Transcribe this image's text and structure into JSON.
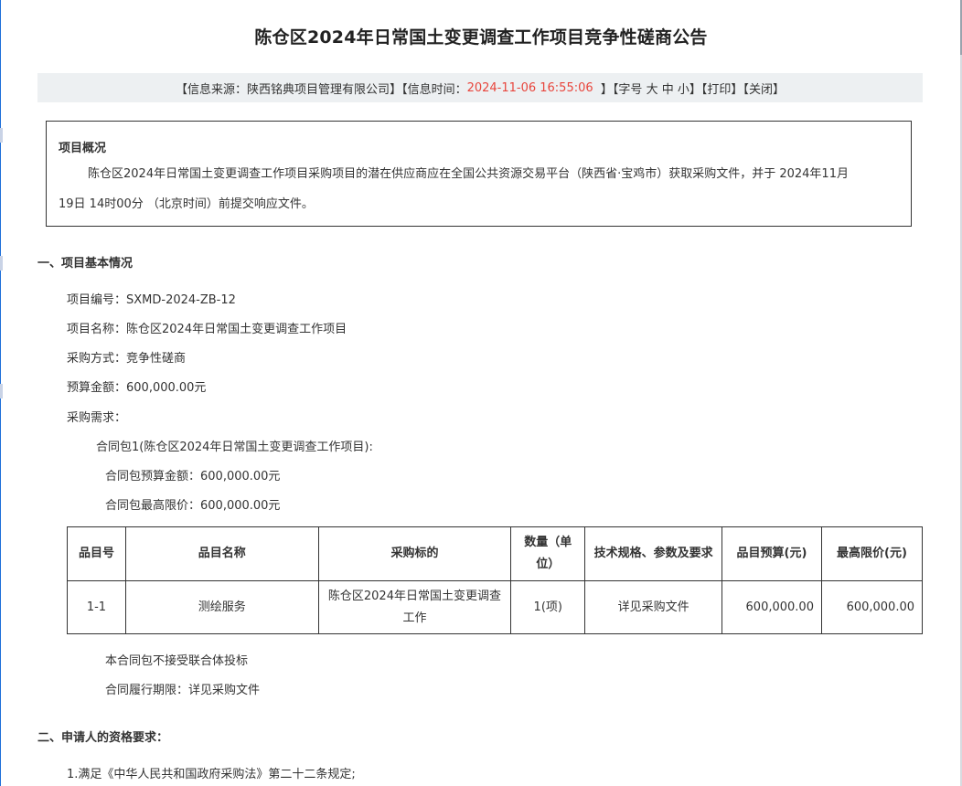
{
  "page": {
    "title": "陈仓区2024年日常国土变更调查工作项目竞争性磋商公告"
  },
  "info_bar": {
    "source_prefix": "【信息来源：",
    "source": "陕西铭典项目管理有限公司",
    "source_suffix": "】【信息时间：",
    "time": "2024-11-06 16:55:06",
    "time_suffix": "  】【字号 ",
    "font_large": "大",
    "font_medium": "中",
    "font_small": "小",
    "font_suffix": "】【",
    "print": "打印",
    "mid": "】【",
    "close": "关闭",
    "end": "】",
    "time_color": "#e8453c"
  },
  "overview": {
    "title": "项目概况",
    "line1": "陈仓区2024年日常国土变更调查工作项目采购项目的潜在供应商应在全国公共资源交易平台（陕西省·宝鸡市）获取采购文件，并于 2024年11月",
    "line2": "19日 14时00分 （北京时间）前提交响应文件。"
  },
  "section1": {
    "heading": "一、项目基本情况",
    "project_no": "项目编号：SXMD-2024-ZB-12",
    "project_name": "项目名称：陈仓区2024年日常国土变更调查工作项目",
    "method": "采购方式：竞争性磋商",
    "budget": "预算金额：600,000.00元",
    "requirement": "采购需求：",
    "package": "合同包1(陈仓区2024年日常国土变更调查工作项目):",
    "package_budget": "合同包预算金额：600,000.00元",
    "package_max": "合同包最高限价：600,000.00元",
    "table": {
      "headers": [
        "品目号",
        "品目名称",
        "采购标的",
        "数量（单位）",
        "技术规格、参数及要求",
        "品目预算(元)",
        "最高限价(元)"
      ],
      "rows": [
        [
          "1-1",
          "测绘服务",
          "陈仓区2024年日常国土变更调查工作",
          "1(项)",
          "详见采购文件",
          "600,000.00",
          "600,000.00"
        ]
      ]
    },
    "no_joint": "本合同包不接受联合体投标",
    "period": "合同履行期限：详见采购文件"
  },
  "section2": {
    "heading": "二、申请人的资格要求：",
    "item1": "1.满足《中华人民共和国政府采购法》第二十二条规定;"
  }
}
